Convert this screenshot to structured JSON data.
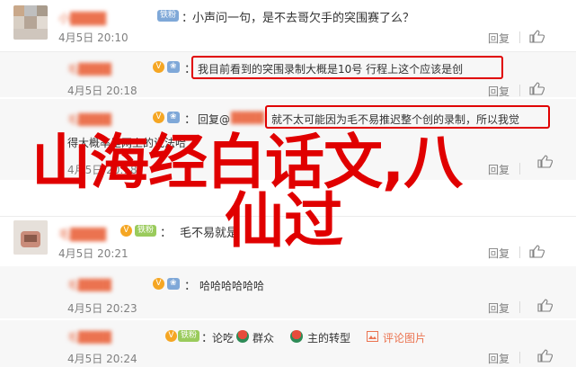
{
  "comments": [
    {
      "username": "小████",
      "badge": "铁粉",
      "text": "小声问一句，是不去哥欠手的突围赛了么？",
      "date": "4月5日 20:10",
      "reply_label": "回复"
    },
    {
      "username": "毛████",
      "badge": "V",
      "text": "我目前看到的突围录制大概是10号 行程上这个应该是创",
      "date": "4月5日 20:18",
      "reply_label": "回复"
    },
    {
      "username": "毛████",
      "reply_prefix": "回复@",
      "reply_target": "████",
      "text": "就不太可能因为毛不易推迟整个创的录制，所以我觉",
      "partial_line": "得大概率是网上的说法哈",
      "partial_line_tail": "觉",
      "date": "4月5日 20:18",
      "reply_label": "回复"
    },
    {
      "username": "毛████",
      "badge": "铁粉",
      "text": "毛不易就是",
      "date": "4月5日 20:21",
      "reply_label": "回复"
    },
    {
      "username": "毛████",
      "text": "哈哈哈哈哈哈",
      "date": "4月5日 20:23",
      "reply_label": "回复"
    },
    {
      "username": "毛████",
      "badge": "铁粉",
      "text_parts": [
        "论吃",
        "群众",
        "主的转型"
      ],
      "report_label": "评论图片",
      "date": "4月5日 20:24",
      "reply_label": "回复"
    }
  ],
  "overlay": {
    "line1": "山海经白话文,八",
    "line2": "仙过"
  },
  "colors": {
    "overlay": "#e00000",
    "username": "#eb7350",
    "meta": "#808080"
  }
}
